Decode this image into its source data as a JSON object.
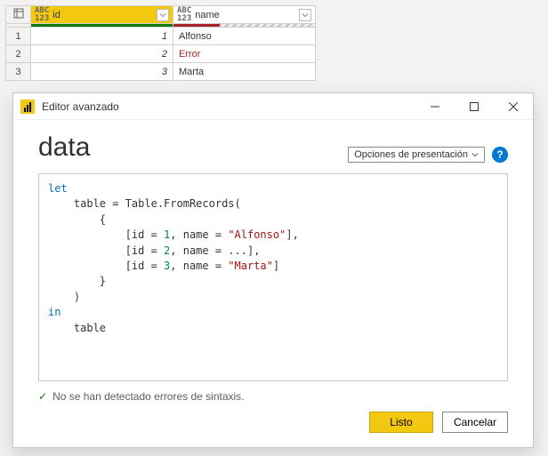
{
  "grid": {
    "columns": [
      {
        "name": "id",
        "type_label": "ABC\n123"
      },
      {
        "name": "name",
        "type_label": "ABC\n123"
      }
    ],
    "rows": [
      {
        "n": "1",
        "id": "1",
        "name": "Alfonso",
        "err": false
      },
      {
        "n": "2",
        "id": "2",
        "name": "Error",
        "err": true
      },
      {
        "n": "3",
        "id": "3",
        "name": "Marta",
        "err": false
      }
    ]
  },
  "editor": {
    "window_title": "Editor avanzado",
    "query_name": "data",
    "options_label": "Opciones de presentación",
    "help_glyph": "?",
    "code": {
      "l1_let": "let",
      "l2": "    table = Table.FromRecords(",
      "l3": "        {",
      "l4_a": "            [id = ",
      "l4_n": "1",
      "l4_b": ", name = ",
      "l4_s": "\"Alfonso\"",
      "l4_c": "],",
      "l5_a": "            [id = ",
      "l5_n": "2",
      "l5_b": ", name = ...],",
      "l6_a": "            [id = ",
      "l6_n": "3",
      "l6_b": ", name = ",
      "l6_s": "\"Marta\"",
      "l6_c": "]",
      "l7": "        }",
      "l8": "    )",
      "l9_in": "in",
      "l10": "    table"
    },
    "status_text": "No se han detectado errores de sintaxis.",
    "done_label": "Listo",
    "cancel_label": "Cancelar"
  }
}
